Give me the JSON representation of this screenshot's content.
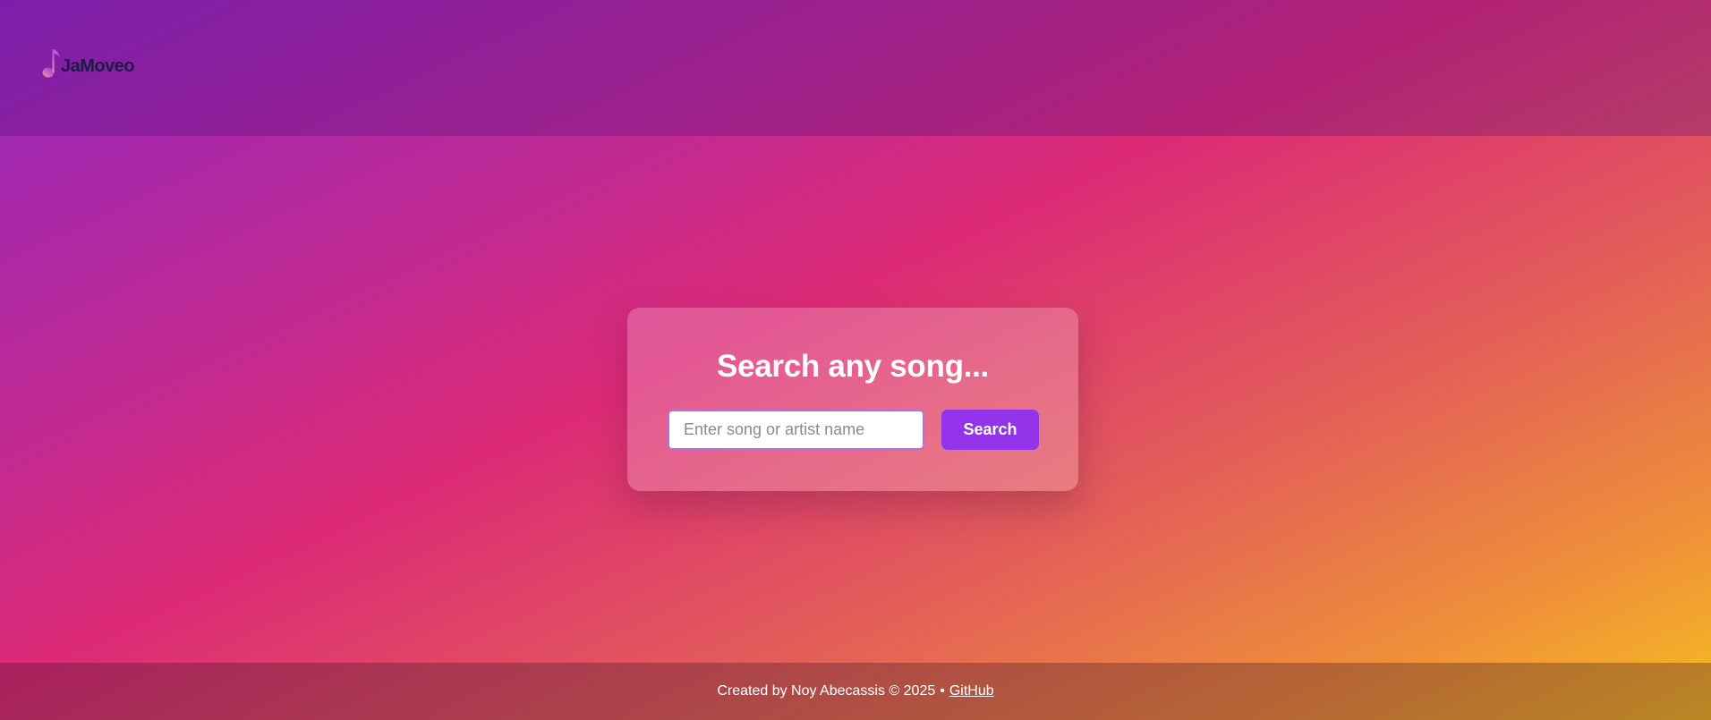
{
  "header": {
    "logo_text": "JaMoveo",
    "logo_icon": "music-note-icon"
  },
  "search_card": {
    "title": "Search any song...",
    "input_placeholder": "Enter song or artist name",
    "input_value": "",
    "button_label": "Search"
  },
  "footer": {
    "credit_text": "Created by Noy Abecassis © 2025",
    "separator": "•",
    "link_label": "GitHub"
  },
  "colors": {
    "button": "#9333ea",
    "logo_text": "#1e1a4a"
  }
}
